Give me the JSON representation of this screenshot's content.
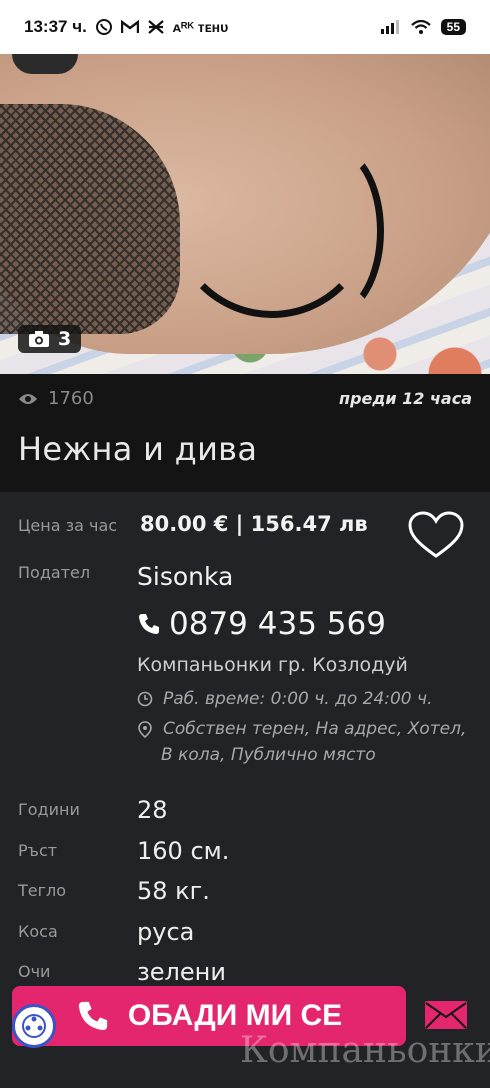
{
  "status_bar": {
    "time": "13:37 ч.",
    "mini_text": "ᴀᴿᴷ ᴛᴇʜᴜ",
    "battery": "55"
  },
  "photo": {
    "count": "3"
  },
  "listing": {
    "views": "1760",
    "posted": "преди 12 часа",
    "title": "Нежна и дива",
    "price_label": "Цена за час",
    "price": "80.00 € | 156.47 лв",
    "poster_label": "Подател",
    "poster": "Sisonka",
    "phone": "0879 435 569",
    "city": "Компаньонки гр. Козлодуй",
    "hours": "Раб. време: 0:00 ч. до 24:00 ч.",
    "location_line1": "Собствен терен, На адрес, Хотел,",
    "location_line2": "В кола, Публично място"
  },
  "details": [
    {
      "label": "Години",
      "value": "28"
    },
    {
      "label": "Ръст",
      "value": "160 см."
    },
    {
      "label": "Тегло",
      "value": "58 кг."
    },
    {
      "label": "Коса",
      "value": "руса"
    },
    {
      "label": "Очи",
      "value": "зелени"
    }
  ],
  "call_button": {
    "label": "ОБАДИ МИ СЕ"
  },
  "watermark": "Компаньонки",
  "colors": {
    "accent": "#e3266e",
    "background": "#141414",
    "panel": "#222326"
  }
}
